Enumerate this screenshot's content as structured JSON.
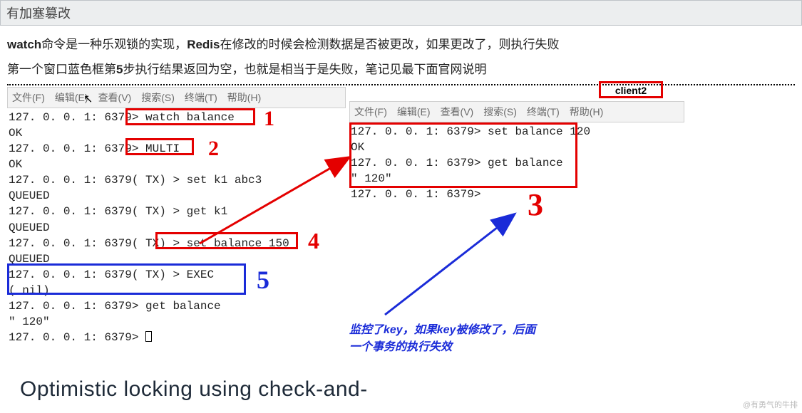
{
  "title": "有加塞篡改",
  "desc1_a": "watch",
  "desc1_b": "命令是一种乐观锁的实现，",
  "desc1_c": "Redis",
  "desc1_d": "在修改的时候会检测数据是否被更改，如果更改了，则执行失败",
  "desc2_a": "第一个窗口蓝色框第",
  "desc2_b": "5",
  "desc2_c": "步执行结果返回为空，也就是相当于是失败，笔记见最下面官网说明",
  "menu": {
    "file": "文件(F)",
    "edit": "编辑(E)",
    "view": "查看(V)",
    "search": "搜索(S)",
    "term": "终端(T)",
    "help": "帮助(H)"
  },
  "client2_label": "client2",
  "left_lines": [
    "127. 0. 0. 1: 6379> watch balance",
    "OK",
    "127. 0. 0. 1: 6379> MULTI",
    "OK",
    "127. 0. 0. 1: 6379( TX) > set k1 abc3",
    "QUEUED",
    "127. 0. 0. 1: 6379( TX) > get k1",
    "QUEUED",
    "127. 0. 0. 1: 6379( TX) > set balance 150",
    "QUEUED",
    "127. 0. 0. 1: 6379( TX) > EXEC",
    "( nil)",
    "127. 0. 0. 1: 6379> get balance",
    "\" 120\"",
    "127. 0. 0. 1: 6379> "
  ],
  "right_lines": [
    "127. 0. 0. 1: 6379> set balance 120",
    "OK",
    "127. 0. 0. 1: 6379> get balance",
    "\" 120\"",
    "127. 0. 0. 1: 6379>"
  ],
  "nums": {
    "n1": "1",
    "n2": "2",
    "n3": "3",
    "n4": "4",
    "n5": "5"
  },
  "note_l1": "监控了key，如果key被修改了，后面",
  "note_l2": "一个事务的执行失效",
  "footer": "Optimistic locking using check-and-",
  "watermark": "@有勇气的牛排"
}
